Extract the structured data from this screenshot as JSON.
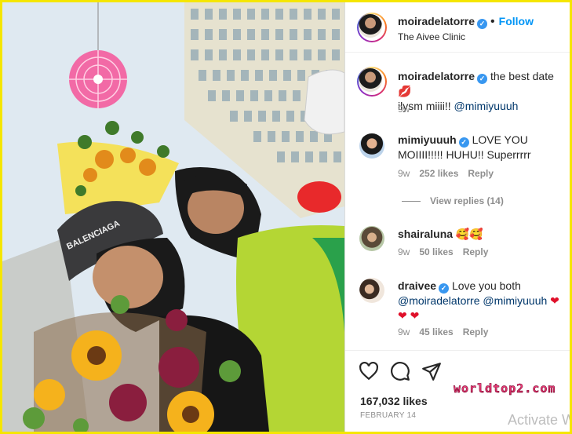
{
  "header": {
    "username": "moiradelatorre",
    "follow_label": "Follow",
    "location": "The Aivee Clinic"
  },
  "caption": {
    "username": "moiradelatorre",
    "text": "the best date",
    "text_line2": "ilysm miiii!!",
    "mention": "@mimiyuuuh",
    "time": "9w"
  },
  "comments": [
    {
      "username": "mimiyuuuh",
      "verified": true,
      "text": "LOVE YOU MOIIII!!!!! HUHU!! Superrrrr",
      "time": "9w",
      "likes": "252 likes",
      "reply": "Reply",
      "view_replies": "View replies (14)"
    },
    {
      "username": "shairaluna",
      "verified": false,
      "text": "🥰🥰",
      "time": "9w",
      "likes": "50 likes",
      "reply": "Reply"
    },
    {
      "username": "draivee",
      "verified": true,
      "text": "Love you both",
      "mentions": "@moiradelatorre @mimiyuuuh",
      "time": "9w",
      "likes": "45 likes",
      "reply": "Reply"
    }
  ],
  "footer": {
    "likes": "167,032 likes",
    "date": "FEBRUARY 14",
    "watermark": "worldtop2.com",
    "activate": "Activate W"
  },
  "icons": {
    "like": "heart-icon",
    "comment": "comment-icon",
    "share": "paper-plane-icon",
    "verified": "verified-badge-icon"
  },
  "colors": {
    "follow": "#0095f6",
    "verified": "#3897f0",
    "border": "#f5e600"
  }
}
